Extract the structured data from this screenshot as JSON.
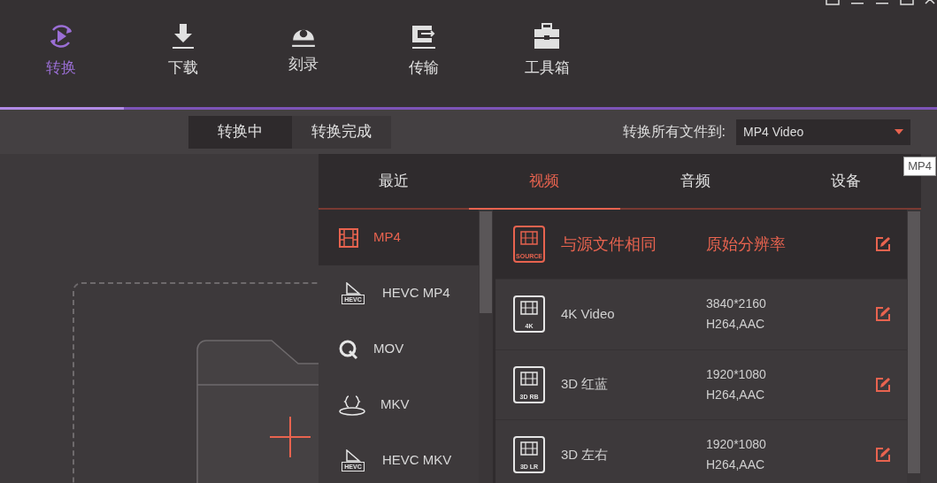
{
  "nav": [
    {
      "label": "转换",
      "selected": true
    },
    {
      "label": "下载",
      "selected": false
    },
    {
      "label": "刻录",
      "selected": false
    },
    {
      "label": "传输",
      "selected": false
    },
    {
      "label": "工具箱",
      "selected": false
    }
  ],
  "subtabs": [
    {
      "label": "转换中",
      "selected": true
    },
    {
      "label": "转换完成",
      "selected": false
    }
  ],
  "convert_all": {
    "label": "转换所有文件到:",
    "value": "MP4 Video"
  },
  "tooltip": "MP4",
  "format_panel": {
    "tabs": [
      {
        "label": "最近",
        "selected": false
      },
      {
        "label": "视频",
        "selected": true
      },
      {
        "label": "音频",
        "selected": false
      },
      {
        "label": "设备",
        "selected": false
      }
    ],
    "formats": [
      {
        "kind": "film",
        "label": "MP4",
        "selected": true
      },
      {
        "kind": "hevc",
        "badge": "HEVC",
        "label": "HEVC MP4",
        "selected": false
      },
      {
        "kind": "q",
        "label": "MOV",
        "selected": false
      },
      {
        "kind": "braces",
        "label": "MKV",
        "selected": false
      },
      {
        "kind": "hevc",
        "badge": "HEVC",
        "label": "HEVC MKV",
        "selected": false
      }
    ],
    "presets": [
      {
        "badge": "SOURCE",
        "name": "与源文件相同",
        "resolution": "原始分辨率",
        "selected": true
      },
      {
        "badge": "4K",
        "name": "4K Video",
        "resolution": "3840*2160",
        "codec": "H264,AAC",
        "selected": false
      },
      {
        "badge": "3D RB",
        "name": "3D 红蓝",
        "resolution": "1920*1080",
        "codec": "H264,AAC",
        "selected": false
      },
      {
        "badge": "3D LR",
        "name": "3D 左右",
        "resolution": "1920*1080",
        "codec": "H264,AAC",
        "selected": false
      }
    ]
  }
}
